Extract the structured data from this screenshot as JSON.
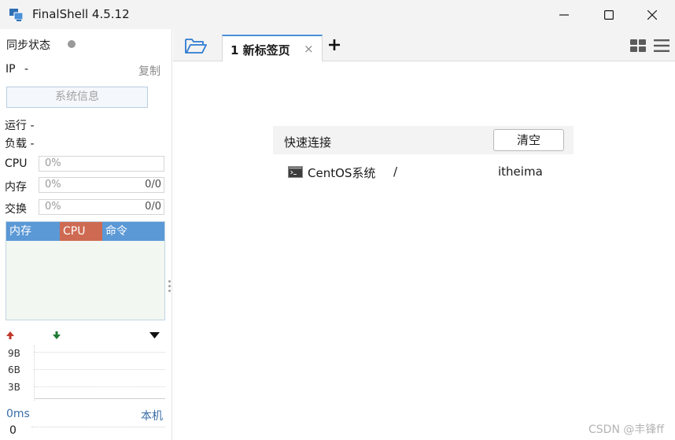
{
  "window": {
    "title": "FinalShell 4.5.12",
    "controls": {
      "minimize_icon": "minimize-icon",
      "maximize_icon": "maximize-icon",
      "close_icon": "close-icon"
    }
  },
  "sidebar": {
    "sync_status_label": "同步状态",
    "ip_label": "IP",
    "ip_value": "-",
    "copy_label": "复制",
    "system_info_button": "系统信息",
    "run_label": "运行 -",
    "load_label": "负载 -",
    "meters": [
      {
        "label": "CPU",
        "percent": "0%",
        "ratio": ""
      },
      {
        "label": "内存",
        "percent": "0%",
        "ratio": "0/0"
      },
      {
        "label": "交换",
        "percent": "0%",
        "ratio": "0/0"
      }
    ],
    "process_table": {
      "columns": [
        "内存",
        "CPU",
        "命令"
      ]
    },
    "network": {
      "ticks": [
        "9B",
        "6B",
        "3B"
      ]
    },
    "latency": {
      "value": "0ms",
      "host_label": "本机",
      "count": "0"
    }
  },
  "tabs": {
    "items": [
      {
        "label": "1  新标签页"
      }
    ],
    "close_glyph": "×"
  },
  "quick_connect": {
    "title": "快速连接",
    "clear_button": "清空",
    "connections": [
      {
        "name": "CentOS系统",
        "path": "/",
        "user": "itheima"
      }
    ]
  },
  "watermark": "CSDN @丰锋ff",
  "colors": {
    "tab_accent": "#4a90d9",
    "process_header": "#5b98d6",
    "cpu_header": "#cf6a52",
    "upload_arrow": "#c0392b",
    "download_arrow": "#1e7b34",
    "link": "#3a6ea8"
  }
}
